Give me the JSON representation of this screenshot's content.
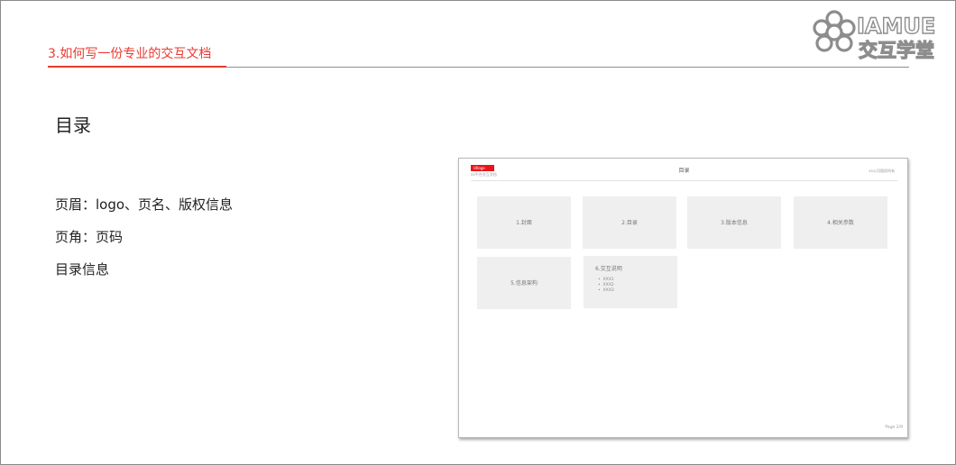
{
  "header": {
    "section_title": "3.如何写一份专业的交互文档",
    "accent_color": "#e83a2f"
  },
  "brand": {
    "logo_icon": "flower-knot-icon",
    "name_en": "IAMUE",
    "name_cn": "交互学堂"
  },
  "content": {
    "heading": "目录",
    "items": [
      "页眉：logo、页名、版权信息",
      "页角：页码",
      "目录信息"
    ]
  },
  "preview": {
    "logo_text": "UIlogo",
    "logo_subtext": "xx平台交互文档",
    "page_title": "目录",
    "copyright": "xx公司版权所有",
    "cards": [
      {
        "label": "1.封面"
      },
      {
        "label": "2.目录"
      },
      {
        "label": "3.版本信息"
      },
      {
        "label": "4.相关参数"
      },
      {
        "label": "5.信息架构"
      },
      {
        "label": "6.交互说明",
        "items": [
          "XXX1",
          "XXX2",
          "XXX3"
        ]
      }
    ],
    "page_number": "Page 2/9"
  }
}
